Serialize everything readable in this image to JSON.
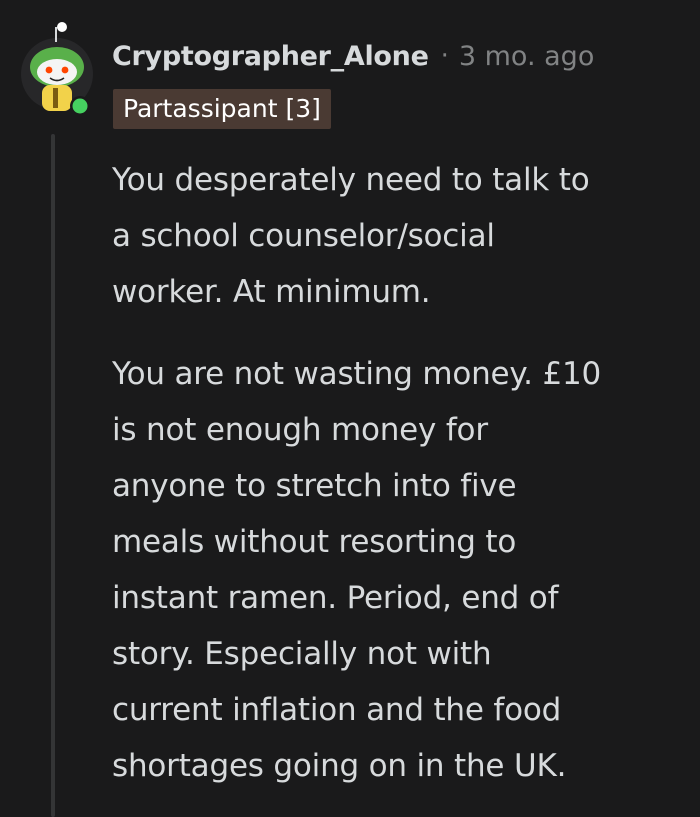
{
  "comment": {
    "author": {
      "username": "Cryptographer_Alone",
      "avatar_icon": "snoo-avatar-icon",
      "online_status": "online",
      "online_color": "#46d160"
    },
    "separator": "·",
    "timestamp": "3 mo. ago",
    "flair": {
      "text": "Partassipant [3]",
      "background": "#4a3a33"
    },
    "paragraphs": [
      "You desperately need to talk to\na school counselor/social\nworker. At minimum.",
      "You are not wasting money. £10\nis not enough money for\nanyone to stretch into five\nmeals without resorting to\ninstant ramen. Period, end of\nstory. Especially not with\ncurrent inflation and the food\nshortages going on in the UK."
    ]
  },
  "theme": {
    "background": "#1a1a1b",
    "text": "#d7dadc",
    "muted": "#818384",
    "thread_line": "#343536"
  }
}
